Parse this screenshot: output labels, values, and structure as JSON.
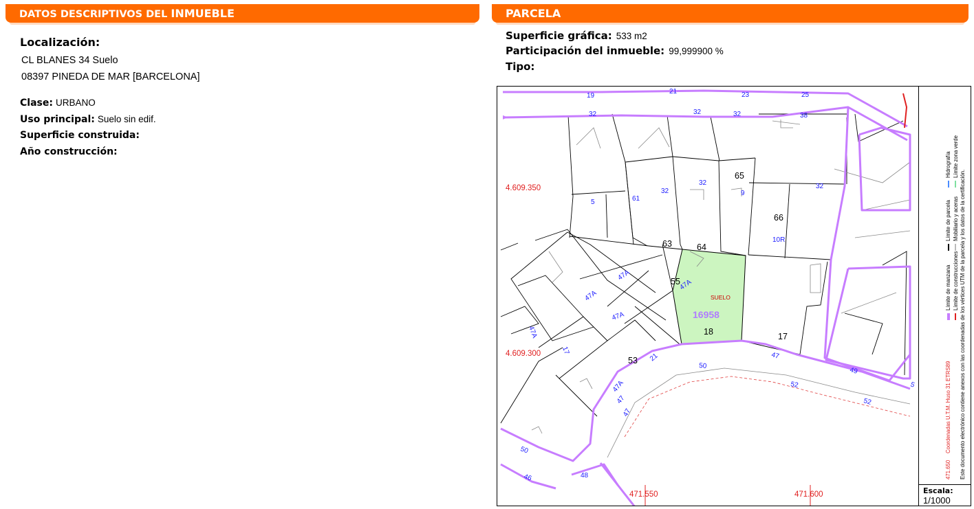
{
  "left_panel": {
    "header_prefix": "DATOS DESCRIPTIVOS DEL ",
    "header_bold": "INMUEBLE",
    "location_label": "Localización:",
    "location_line1": "CL BLANES 34 Suelo",
    "location_line2": "08397 PINEDA DE MAR [BARCELONA]",
    "clase_label": "Clase:",
    "clase_value": "URBANO",
    "uso_label": "Uso principal:",
    "uso_value": "Suelo sin edif.",
    "superficie_construida_label": "Superficie construida:",
    "ano_label": "Año construcción:"
  },
  "right_panel": {
    "header": "PARCELA",
    "superficie_grafica_label": "Superficie gráfica:",
    "superficie_grafica_value": "533 m2",
    "participacion_label": "Participación del inmueble:",
    "participacion_value": "99,999900 %",
    "tipo_label": "Tipo:"
  },
  "map": {
    "parcel_id": "16958",
    "parcel_use": "SUELO",
    "coord_y1": "4.609.350",
    "coord_y2": "4.609.300",
    "coord_x1": "471.550",
    "coord_x2": "471.600",
    "coord_x3": "471.650",
    "coord_system": "Coordenadas U.T.M. Huso 31 ETRS89",
    "block_numbers": [
      "65",
      "66",
      "63",
      "64",
      "55",
      "18",
      "17",
      "53"
    ],
    "street_numbers": [
      "19",
      "21",
      "23",
      "25",
      "32",
      "32",
      "32",
      "38",
      "32",
      "32",
      "32",
      "9",
      "5",
      "61",
      "10R",
      "47A",
      "47A",
      "47A",
      "47A",
      "47A",
      "17",
      "21",
      "47",
      "50",
      "52",
      "52",
      "49",
      "5",
      "47",
      "47",
      "50",
      "46",
      "48",
      "47A"
    ],
    "legend": {
      "limite_manzana": "Límite de manzana",
      "limite_construcciones": "Límite de construcciones",
      "limite_parcela": "Límite de parcela",
      "mobiliario": "Mobiliario y aceras",
      "hidrografia": "Hidrografía",
      "zona_verde": "Límite zona verde",
      "note": "Este documento electrónico contiene anexos con las coordenadas de los vértices UTM de la parcela y los datos de la certificación."
    },
    "scale_label": "Escala:",
    "scale_value": "1/1000",
    "colors": {
      "header": "#ff6a00",
      "block_limit": "#c77dff",
      "parcel_fill": "#ccf5c0",
      "coord_text": "#e02020",
      "street_number": "#1a1aff",
      "parcel_id_text": "#b07dff"
    }
  }
}
